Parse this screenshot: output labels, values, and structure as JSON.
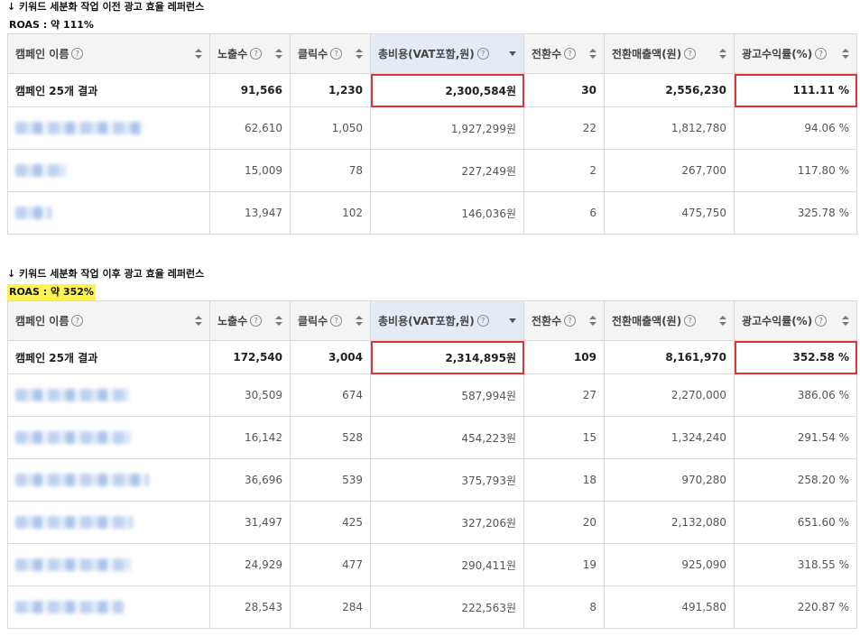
{
  "before": {
    "caption": "↓ 키워드 세분화 작업 이전 광고 효율 레퍼런스",
    "roas": "ROAS : 약 111%",
    "headers": [
      "캠페인 이름",
      "노출수",
      "클릭수",
      "총비용(VAT포함,원)",
      "전환수",
      "전환매출액(원)",
      "광고수익률(%)"
    ],
    "total": {
      "name": "캠페인 25개 결과",
      "impressions": "91,566",
      "clicks": "1,230",
      "cost": "2,300,584원",
      "conversions": "30",
      "revenue": "2,556,230",
      "roas": "111.11 %"
    },
    "rows": [
      {
        "impressions": "62,610",
        "clicks": "1,050",
        "cost": "1,927,299원",
        "conversions": "22",
        "revenue": "1,812,780",
        "roas": "94.06 %"
      },
      {
        "impressions": "15,009",
        "clicks": "78",
        "cost": "227,249원",
        "conversions": "2",
        "revenue": "267,700",
        "roas": "117.80 %"
      },
      {
        "impressions": "13,947",
        "clicks": "102",
        "cost": "146,036원",
        "conversions": "6",
        "revenue": "475,750",
        "roas": "325.78 %"
      }
    ]
  },
  "after": {
    "caption": "↓ 키워드 세분화 작업 이후 광고 효율 레퍼런스",
    "roas": "ROAS : 약 352%",
    "headers": [
      "캠페인 이름",
      "노출수",
      "클릭수",
      "총비용(VAT포함,원)",
      "전환수",
      "전환매출액(원)",
      "광고수익률(%)"
    ],
    "total": {
      "name": "캠페인 25개 결과",
      "impressions": "172,540",
      "clicks": "3,004",
      "cost": "2,314,895원",
      "conversions": "109",
      "revenue": "8,161,970",
      "roas": "352.58 %"
    },
    "rows": [
      {
        "impressions": "30,509",
        "clicks": "674",
        "cost": "587,994원",
        "conversions": "27",
        "revenue": "2,270,000",
        "roas": "386.06 %"
      },
      {
        "impressions": "16,142",
        "clicks": "528",
        "cost": "454,223원",
        "conversions": "15",
        "revenue": "1,324,240",
        "roas": "291.54 %"
      },
      {
        "impressions": "36,696",
        "clicks": "539",
        "cost": "375,793원",
        "conversions": "18",
        "revenue": "970,280",
        "roas": "258.20 %"
      },
      {
        "impressions": "31,497",
        "clicks": "425",
        "cost": "327,206원",
        "conversions": "20",
        "revenue": "2,132,080",
        "roas": "651.60 %"
      },
      {
        "impressions": "24,929",
        "clicks": "477",
        "cost": "290,411원",
        "conversions": "19",
        "revenue": "925,090",
        "roas": "318.55 %"
      },
      {
        "impressions": "28,543",
        "clicks": "284",
        "cost": "222,563원",
        "conversions": "8",
        "revenue": "491,580",
        "roas": "220.87 %"
      }
    ]
  },
  "help_glyph": "?",
  "colors": {
    "highlight_border": "#e03434",
    "roas_highlight_bg": "#fff34d",
    "sorted_header_bg": "#e5ebf5"
  }
}
